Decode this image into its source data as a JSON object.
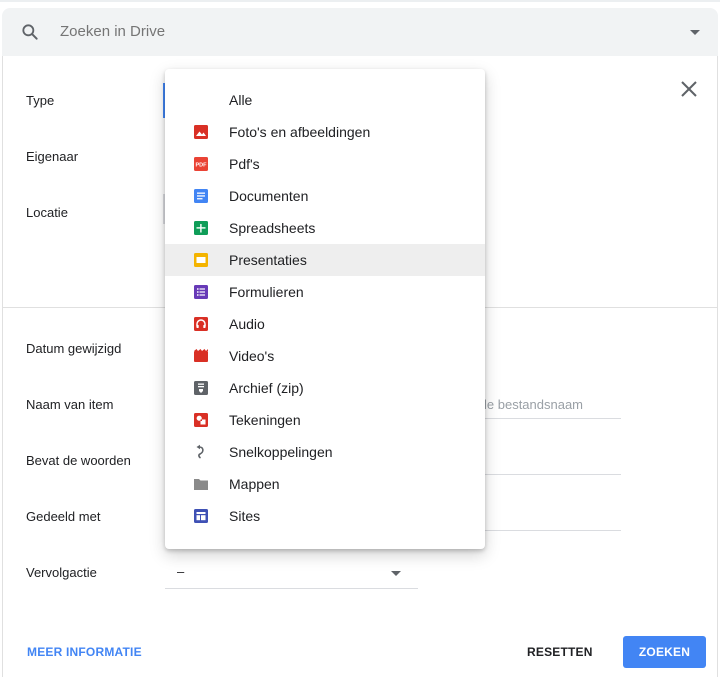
{
  "search": {
    "placeholder": "Zoeken in Drive"
  },
  "form": {
    "labels": {
      "type": "Type",
      "owner": "Eigenaar",
      "location": "Locatie",
      "date_modified": "Datum gewijzigd",
      "item_name": "Naam van item",
      "contains_words": "Bevat de woorden",
      "shared_with": "Gedeeld met",
      "follow_up": "Vervolgactie"
    },
    "item_name_hint": "le bestandsnaam",
    "follow_up_value": "–"
  },
  "actions": {
    "more_info": "MEER INFORMATIE",
    "reset": "RESETTEN",
    "search": "ZOEKEN"
  },
  "dropdown": {
    "items": [
      {
        "label": "Alle",
        "icon": "none"
      },
      {
        "label": "Foto's en afbeeldingen",
        "icon": "image-icon"
      },
      {
        "label": "Pdf's",
        "icon": "pdf-icon"
      },
      {
        "label": "Documenten",
        "icon": "document-icon"
      },
      {
        "label": "Spreadsheets",
        "icon": "spreadsheet-icon"
      },
      {
        "label": "Presentaties",
        "icon": "presentation-icon",
        "highlighted": true
      },
      {
        "label": "Formulieren",
        "icon": "form-icon"
      },
      {
        "label": "Audio",
        "icon": "audio-icon"
      },
      {
        "label": "Video's",
        "icon": "video-icon"
      },
      {
        "label": "Archief (zip)",
        "icon": "archive-icon"
      },
      {
        "label": "Tekeningen",
        "icon": "drawing-icon"
      },
      {
        "label": "Snelkoppelingen",
        "icon": "shortcut-icon"
      },
      {
        "label": "Mappen",
        "icon": "folder-icon"
      },
      {
        "label": "Sites",
        "icon": "sites-icon"
      }
    ]
  },
  "colors": {
    "accent": "#4285f4",
    "image": "#d93025",
    "pdf": "#ea4335",
    "document": "#4285f4",
    "spreadsheet": "#0f9d58",
    "presentation": "#f4b400",
    "form": "#673ab7",
    "audio": "#d93025",
    "video": "#d93025",
    "archive": "#5f6368",
    "drawing": "#d93025",
    "shortcut": "#5f6368",
    "folder": "#8a8a8a",
    "sites": "#3f51b5"
  }
}
